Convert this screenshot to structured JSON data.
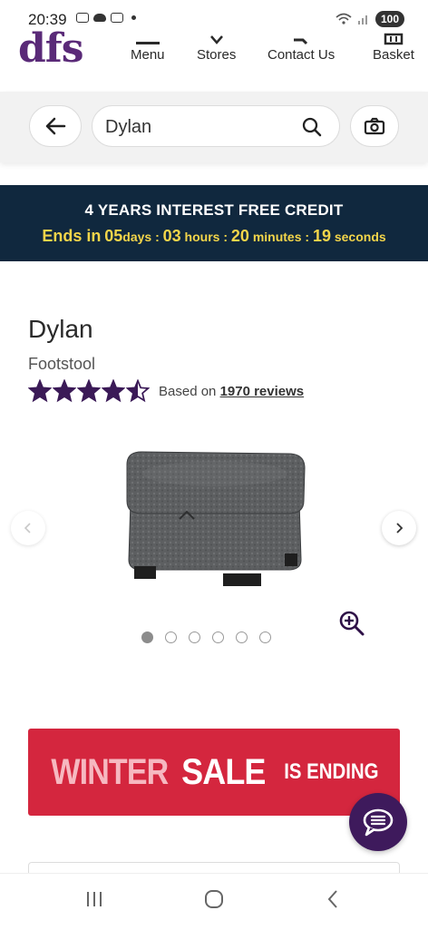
{
  "status_bar": {
    "time": "20:39",
    "battery": "100"
  },
  "header": {
    "logo": "dfs",
    "nav": [
      {
        "label": "Menu",
        "icon": "menu-icon"
      },
      {
        "label": "Stores",
        "icon": "chevron-down-icon"
      },
      {
        "label": "Contact Us",
        "icon": "phone-icon"
      },
      {
        "label": "Basket",
        "icon": "basket-icon"
      }
    ]
  },
  "search": {
    "value": "Dylan",
    "placeholder": ""
  },
  "promo": {
    "title": "4 YEARS INTEREST FREE CREDIT",
    "ends_in": "Ends in",
    "days_value": "05",
    "days_label": "days :",
    "hours_value": "03",
    "hours_label": "hours :",
    "minutes_value": "20",
    "minutes_label": "minutes :",
    "seconds_value": "19",
    "seconds_label": "seconds"
  },
  "product": {
    "name": "Dylan",
    "type": "Footstool",
    "rating_stars": 4.5,
    "rating_prefix": "Based on",
    "reviews_link": "1970 reviews"
  },
  "gallery": {
    "image_count": 6,
    "active_index": 0
  },
  "sale_banner": {
    "word1": "WINTER",
    "word2": "SALE",
    "word3": "IS ENDING"
  },
  "colors": {
    "brand_purple": "#5a2a78",
    "promo_bg": "#10283e",
    "promo_accent": "#f3d54a",
    "sale_red": "#d4263e",
    "star": "#3b1a57"
  }
}
